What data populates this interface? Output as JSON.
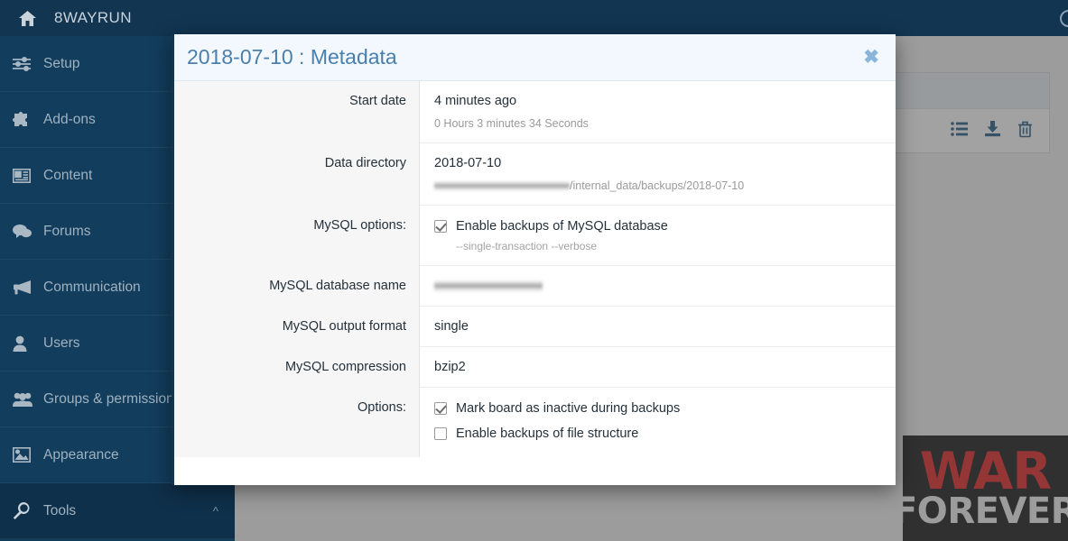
{
  "topbar": {
    "home_icon": "home-icon",
    "brand": "8WAYRUN",
    "search_icon": "search-icon"
  },
  "sidebar": {
    "items": [
      {
        "label": "Setup",
        "icon": "sliders-icon",
        "active": false
      },
      {
        "label": "Add-ons",
        "icon": "puzzle-icon",
        "active": false
      },
      {
        "label": "Content",
        "icon": "newspaper-icon",
        "active": false
      },
      {
        "label": "Forums",
        "icon": "comments-icon",
        "active": false
      },
      {
        "label": "Communication",
        "icon": "bullhorn-icon",
        "active": false
      },
      {
        "label": "Users",
        "icon": "user-icon",
        "active": false
      },
      {
        "label": "Groups & permissions",
        "icon": "users-icon",
        "active": false
      },
      {
        "label": "Appearance",
        "icon": "image-icon",
        "active": false
      },
      {
        "label": "Tools",
        "icon": "wrench-icon",
        "active": true,
        "chevron": "chevron-up-icon"
      }
    ]
  },
  "background_panel": {
    "row_icons": [
      "list-icon",
      "download-icon",
      "trash-icon"
    ]
  },
  "ad_banner": {
    "line1": "WAR",
    "line2": "FOREVER"
  },
  "modal": {
    "title": "2018-07-10 : Metadata",
    "close_icon": "close-icon",
    "rows": [
      {
        "label": "Start date",
        "value": "4 minutes ago",
        "sub": "0 Hours 3 minutes 34 Seconds"
      },
      {
        "label": "Data directory",
        "value": "2018-07-10",
        "sub_path_redacted": true,
        "sub_path_visible": "/internal_data/backups/2018-07-10"
      },
      {
        "label": "MySQL options:",
        "checkbox_label": "Enable backups of MySQL database",
        "checkbox_checked": true,
        "sub": "--single-transaction --verbose"
      },
      {
        "label": "MySQL database name",
        "value_redacted": true
      },
      {
        "label": "MySQL output format",
        "value": "single"
      },
      {
        "label": "MySQL compression",
        "value": "bzip2"
      }
    ],
    "options": {
      "label": "Options:",
      "checkboxes": [
        {
          "label": "Mark board as inactive during backups",
          "checked": true
        },
        {
          "label": "Enable backups of file structure",
          "checked": false
        }
      ]
    }
  },
  "colors": {
    "header_navy": "#123551",
    "sidebar_navy": "#123d5c",
    "sidebar_active": "#0f304a",
    "modal_title_blue": "#4a7fad",
    "modal_header_bg": "#f2f8fd",
    "icon_blue": "#1a5582",
    "ad_red": "#e11b1b"
  }
}
